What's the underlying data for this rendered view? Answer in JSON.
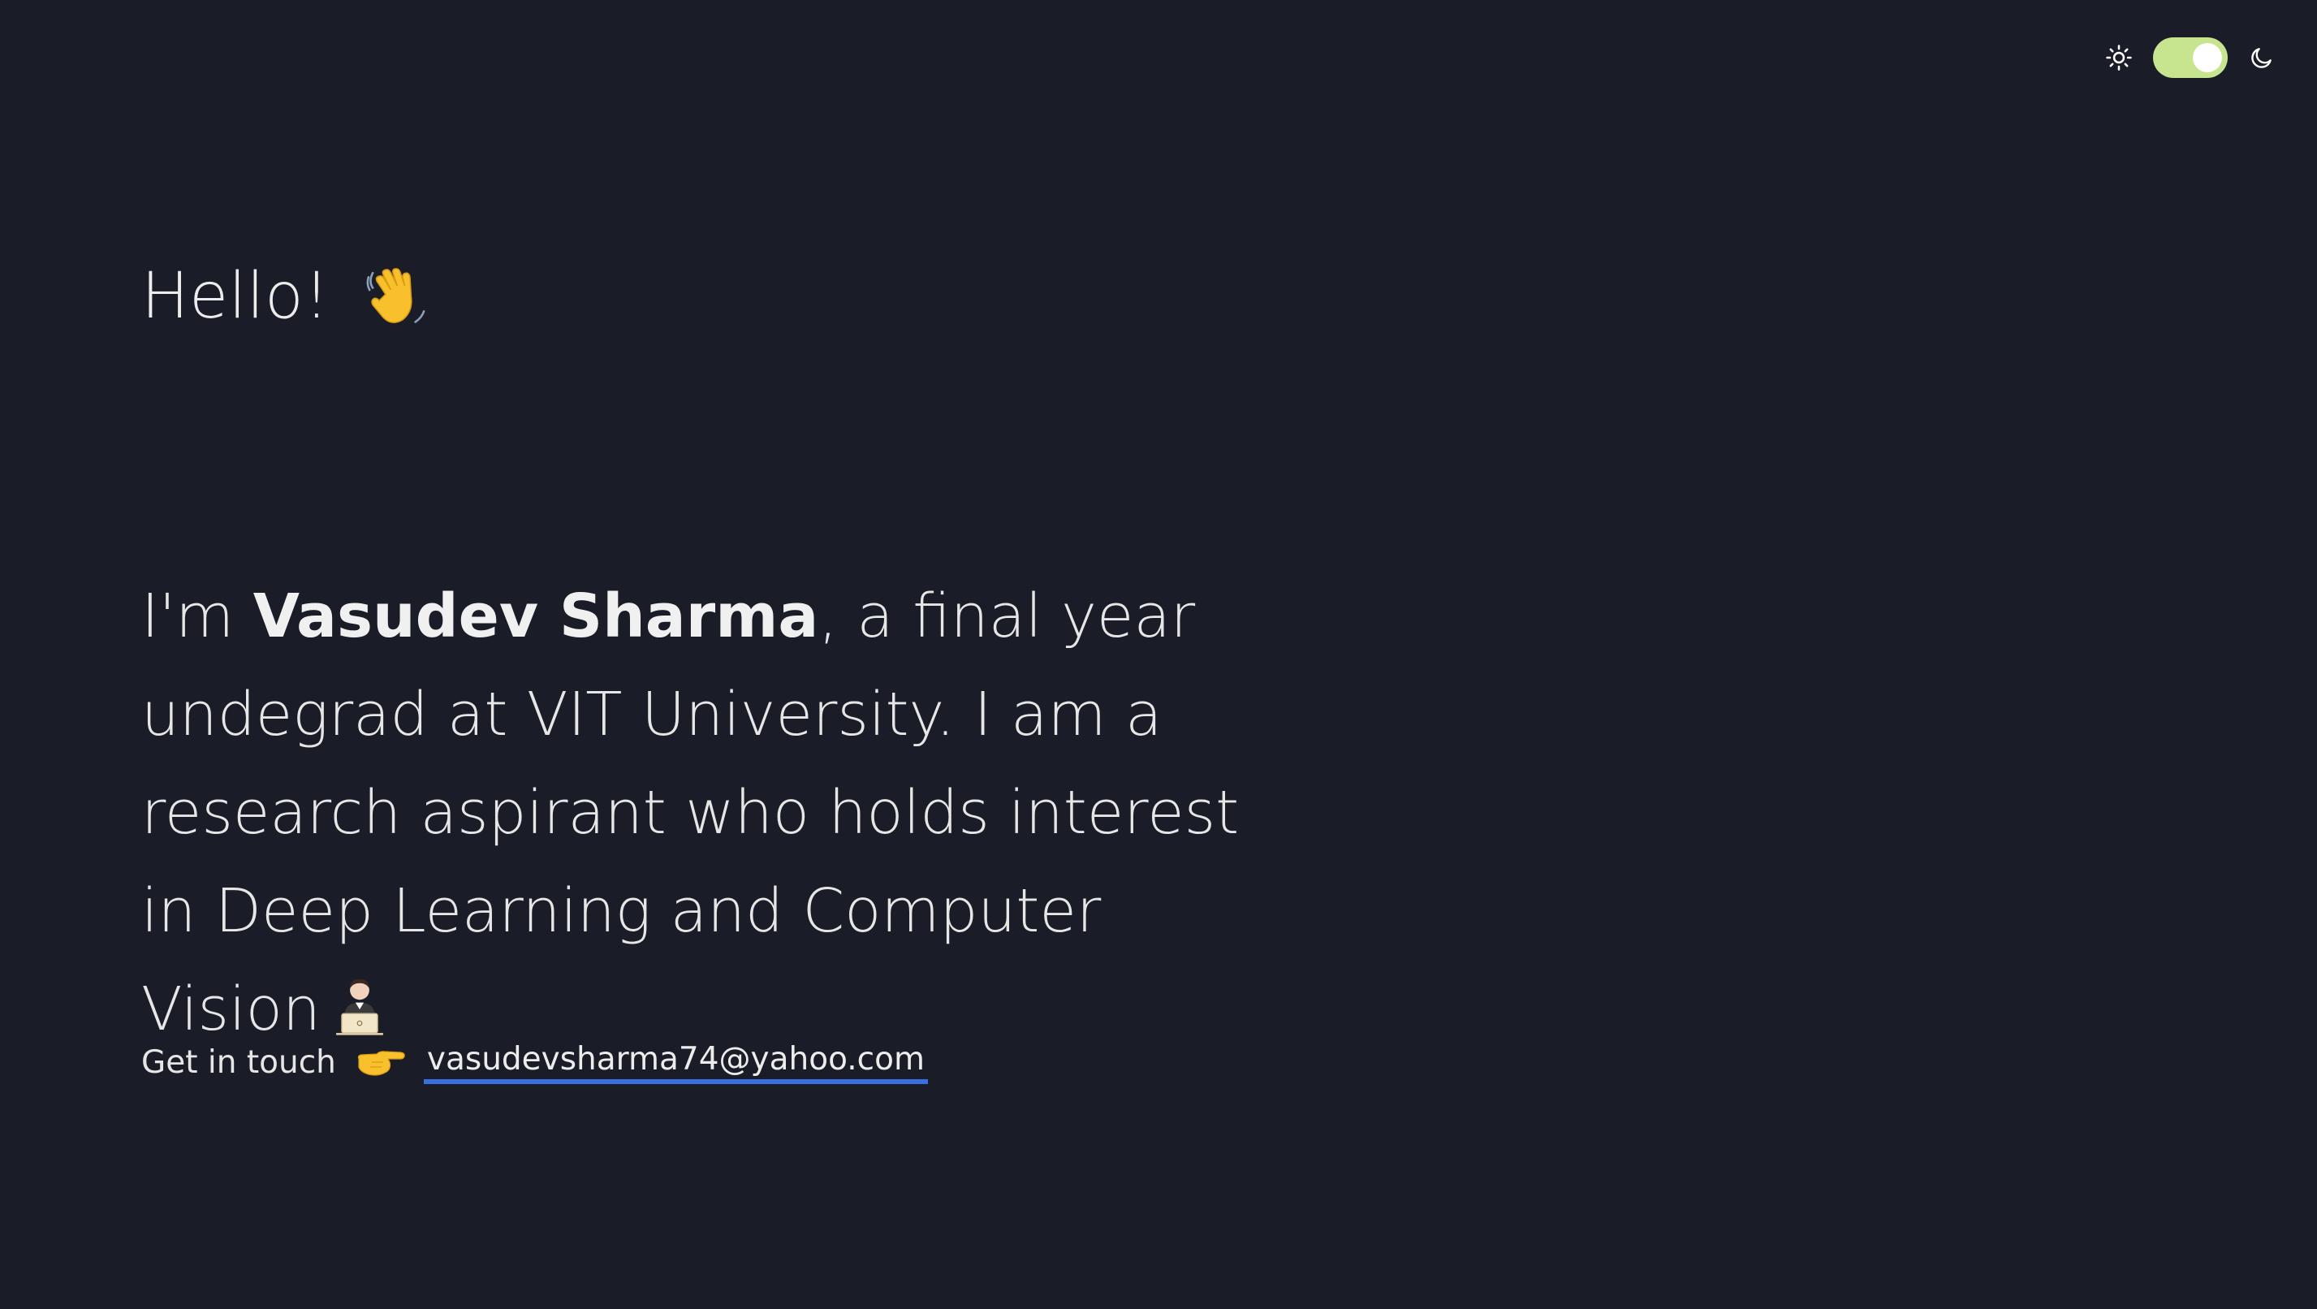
{
  "theme_toggle": {
    "left_icon": "sun-icon",
    "right_icon": "moon-icon",
    "state": "dark",
    "track_color": "#c7e48f"
  },
  "hero": {
    "greeting": "Hello!",
    "greeting_icon": "waving-hand-icon"
  },
  "intro": {
    "prefix": "I'm ",
    "name": "Vasudev Sharma",
    "rest": ", a final year undegrad at VIT University. I am a research aspirant who holds interest in Deep Learning and Computer Vision",
    "trailing_icon": "technologist-icon"
  },
  "contact": {
    "label": "Get in touch",
    "pointer_icon": "pointing-hand-icon",
    "email": "vasudevsharma74@yahoo.com",
    "link_underline_color": "#3a6fe0"
  },
  "colors": {
    "background": "#1a1d27",
    "text": "#e6e6e6"
  }
}
